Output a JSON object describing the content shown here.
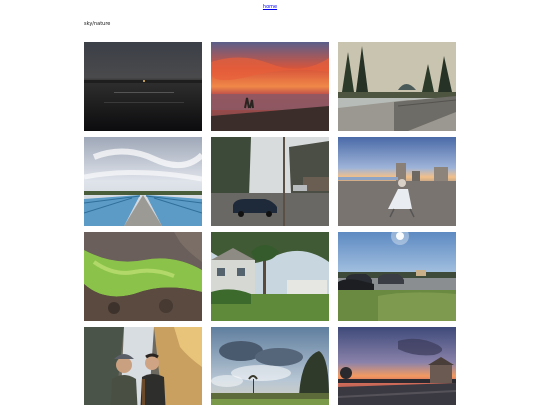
{
  "nav": {
    "home_label": "home"
  },
  "section": {
    "title": "sky/nature"
  },
  "gallery": {
    "photos": [
      {
        "icon": "dusk-lake-photo"
      },
      {
        "icon": "red-sunset-shore-photo"
      },
      {
        "icon": "promenade-trees-photo"
      },
      {
        "icon": "bridge-walkway-photo"
      },
      {
        "icon": "street-parking-lot-photo"
      },
      {
        "icon": "beach-person-chair-photo"
      },
      {
        "icon": "mossy-rock-photo"
      },
      {
        "icon": "house-garden-photo"
      },
      {
        "icon": "parked-cars-sun-photo"
      },
      {
        "icon": "two-people-waterfall-photo"
      },
      {
        "icon": "cloudy-field-photo"
      },
      {
        "icon": "harbor-dusk-photo"
      }
    ]
  }
}
